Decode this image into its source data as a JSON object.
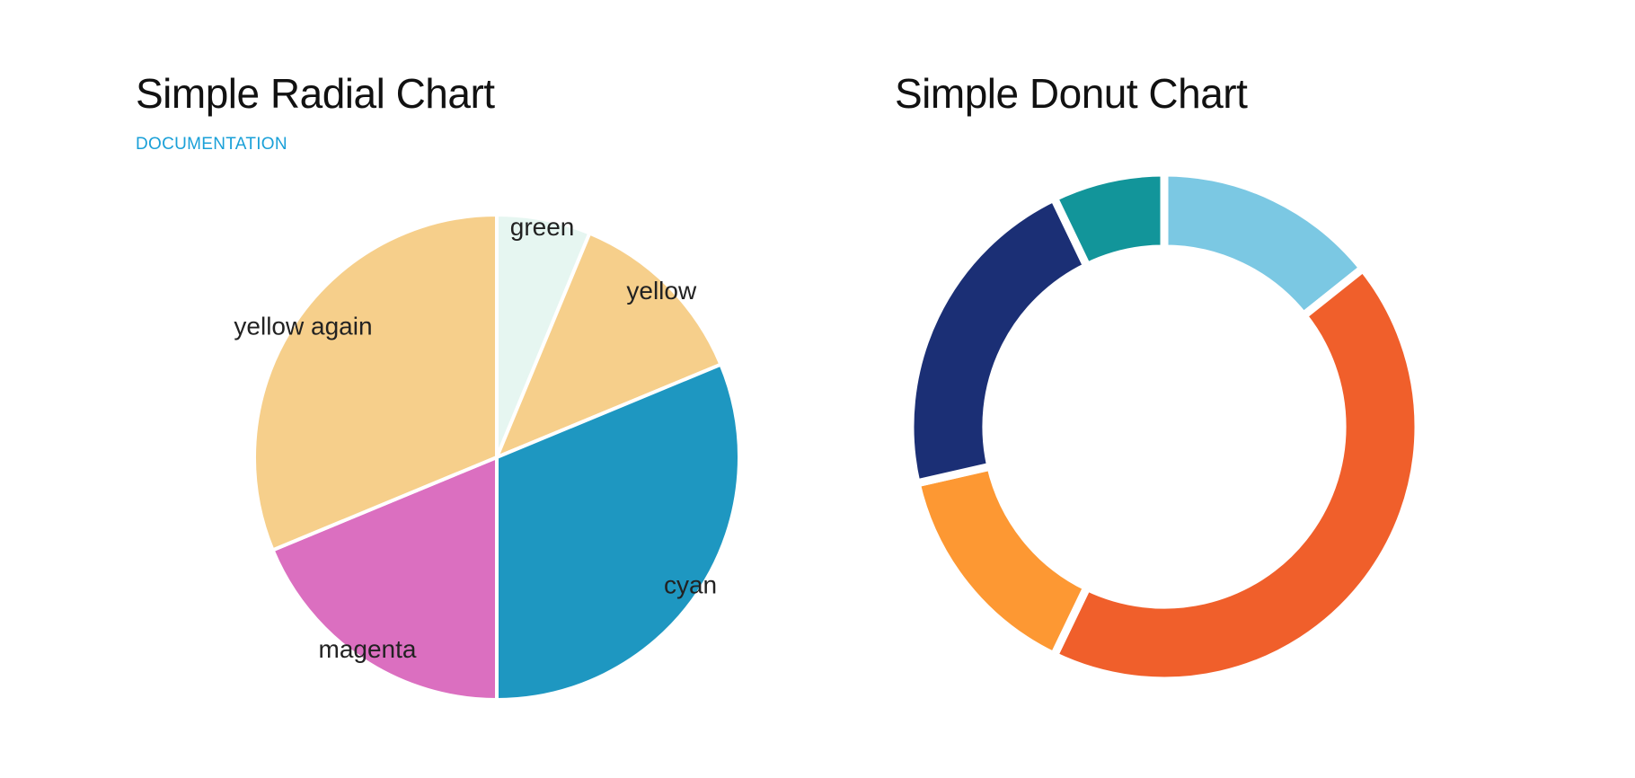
{
  "charts": {
    "radial": {
      "title": "Simple Radial Chart",
      "link_label": "DOCUMENTATION"
    },
    "donut": {
      "title": "Simple Donut Chart"
    }
  },
  "chart_data": [
    {
      "type": "pie",
      "title": "Simple Radial Chart",
      "start_angle_deg": 0,
      "direction": "clockwise",
      "slices": [
        {
          "label": "green",
          "value": 2,
          "color": "#e6f6f1"
        },
        {
          "label": "yellow",
          "value": 4,
          "color": "#f6cf8b"
        },
        {
          "label": "cyan",
          "value": 10,
          "color": "#1e97c1"
        },
        {
          "label": "magenta",
          "value": 6,
          "color": "#db6fc0"
        },
        {
          "label": "yellow again",
          "value": 10,
          "color": "#f6cf8b"
        }
      ]
    },
    {
      "type": "pie",
      "subtype": "donut",
      "title": "Simple Donut Chart",
      "start_angle_deg": 0,
      "direction": "clockwise",
      "inner_radius_ratio": 0.7,
      "slices": [
        {
          "label": "",
          "value": 4,
          "color": "#7bc8e3"
        },
        {
          "label": "",
          "value": 12,
          "color": "#f05f2b"
        },
        {
          "label": "",
          "value": 4,
          "color": "#fd9833"
        },
        {
          "label": "",
          "value": 6,
          "color": "#1b2f75"
        },
        {
          "label": "",
          "value": 2,
          "color": "#12959a"
        }
      ]
    }
  ]
}
